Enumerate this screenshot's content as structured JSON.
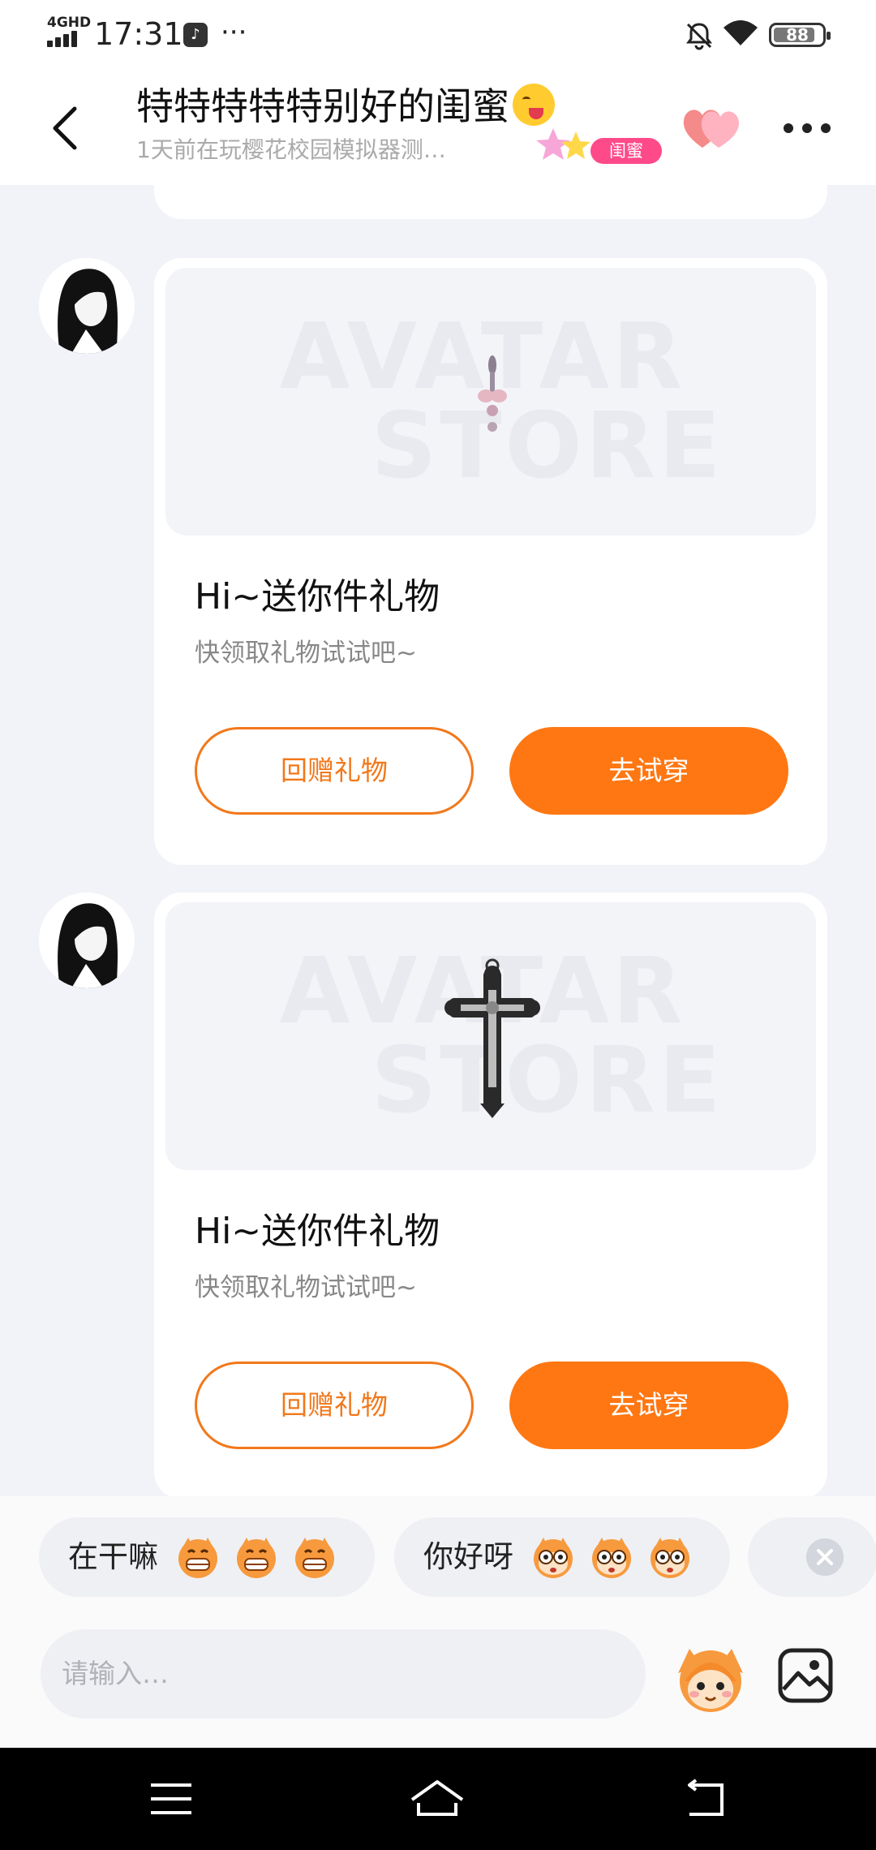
{
  "status_bar": {
    "network": "4GHD",
    "time": "17:31",
    "app_glyph": "♪",
    "overflow": "···",
    "battery": "88"
  },
  "header": {
    "title": "特特特特特别好的闺蜜",
    "subtitle": "1天前在玩樱花校园模拟器测…",
    "badge": "闺蜜"
  },
  "messages": [
    {
      "watermark_line1": "AVATAR",
      "watermark_line2": "STORE",
      "title": "Hi~送你件礼物",
      "subtitle": "快领取礼物试试吧~",
      "return_label": "回赠礼物",
      "tryon_label": "去试穿"
    },
    {
      "watermark_line1": "AVATAR",
      "watermark_line2": "STORE",
      "title": "Hi~送你件礼物",
      "subtitle": "快领取礼物试试吧~",
      "return_label": "回赠礼物",
      "tryon_label": "去试穿"
    }
  ],
  "quick_replies": [
    {
      "text": "在干嘛"
    },
    {
      "text": "你好呀"
    }
  ],
  "input": {
    "placeholder": "请输入…"
  },
  "colors": {
    "accent_orange": "#ff7712",
    "badge_pink": "#ff4a8a",
    "background": "#f2f3f8"
  },
  "icons": [
    "back-arrow-icon",
    "heart-icon",
    "more-icon",
    "mascot-icon",
    "image-icon",
    "close-icon",
    "menu-icon",
    "home-icon",
    "back-nav-icon"
  ]
}
